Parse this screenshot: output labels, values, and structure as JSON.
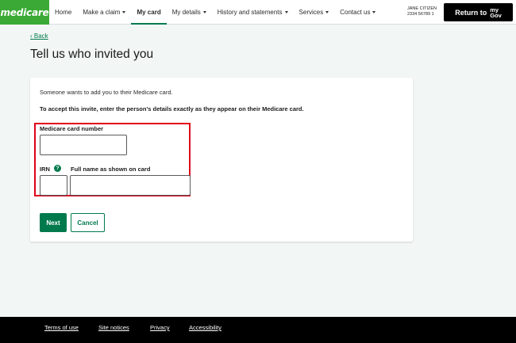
{
  "header": {
    "logo": "medicare",
    "nav": [
      {
        "label": "Home",
        "has_menu": false,
        "active": false
      },
      {
        "label": "Make a claim",
        "has_menu": true,
        "active": false
      },
      {
        "label": "My card",
        "has_menu": false,
        "active": true
      },
      {
        "label": "My details",
        "has_menu": true,
        "active": false
      },
      {
        "label": "History and statements",
        "has_menu": true,
        "active": false
      },
      {
        "label": "Services",
        "has_menu": true,
        "active": false
      },
      {
        "label": "Contact us",
        "has_menu": true,
        "active": false
      }
    ],
    "user_name": "JANE CITIZEN",
    "user_number": "2334 56789 1",
    "return_label": "Return to",
    "mygov_top": "my",
    "mygov_bottom": "Gov"
  },
  "back_label": "Back",
  "page_title": "Tell us who invited you",
  "form": {
    "intro": "Someone wants to add you to their Medicare card.",
    "instruction": "To accept this invite, enter the person's details exactly as they appear on their Medicare card.",
    "card_number_label": "Medicare card number",
    "card_number_value": "",
    "irn_label": "IRN",
    "irn_value": "",
    "help_symbol": "?",
    "full_name_label": "Full name as shown on card",
    "full_name_value": "",
    "next_label": "Next",
    "cancel_label": "Cancel"
  },
  "footer": {
    "links": [
      "Terms of use",
      "Site notices",
      "Privacy",
      "Accessibility"
    ]
  },
  "colors": {
    "brand_green": "#3aa935",
    "primary_green": "#007a4d",
    "highlight_red": "#e0001b",
    "page_bg": "#f2f6f5"
  }
}
